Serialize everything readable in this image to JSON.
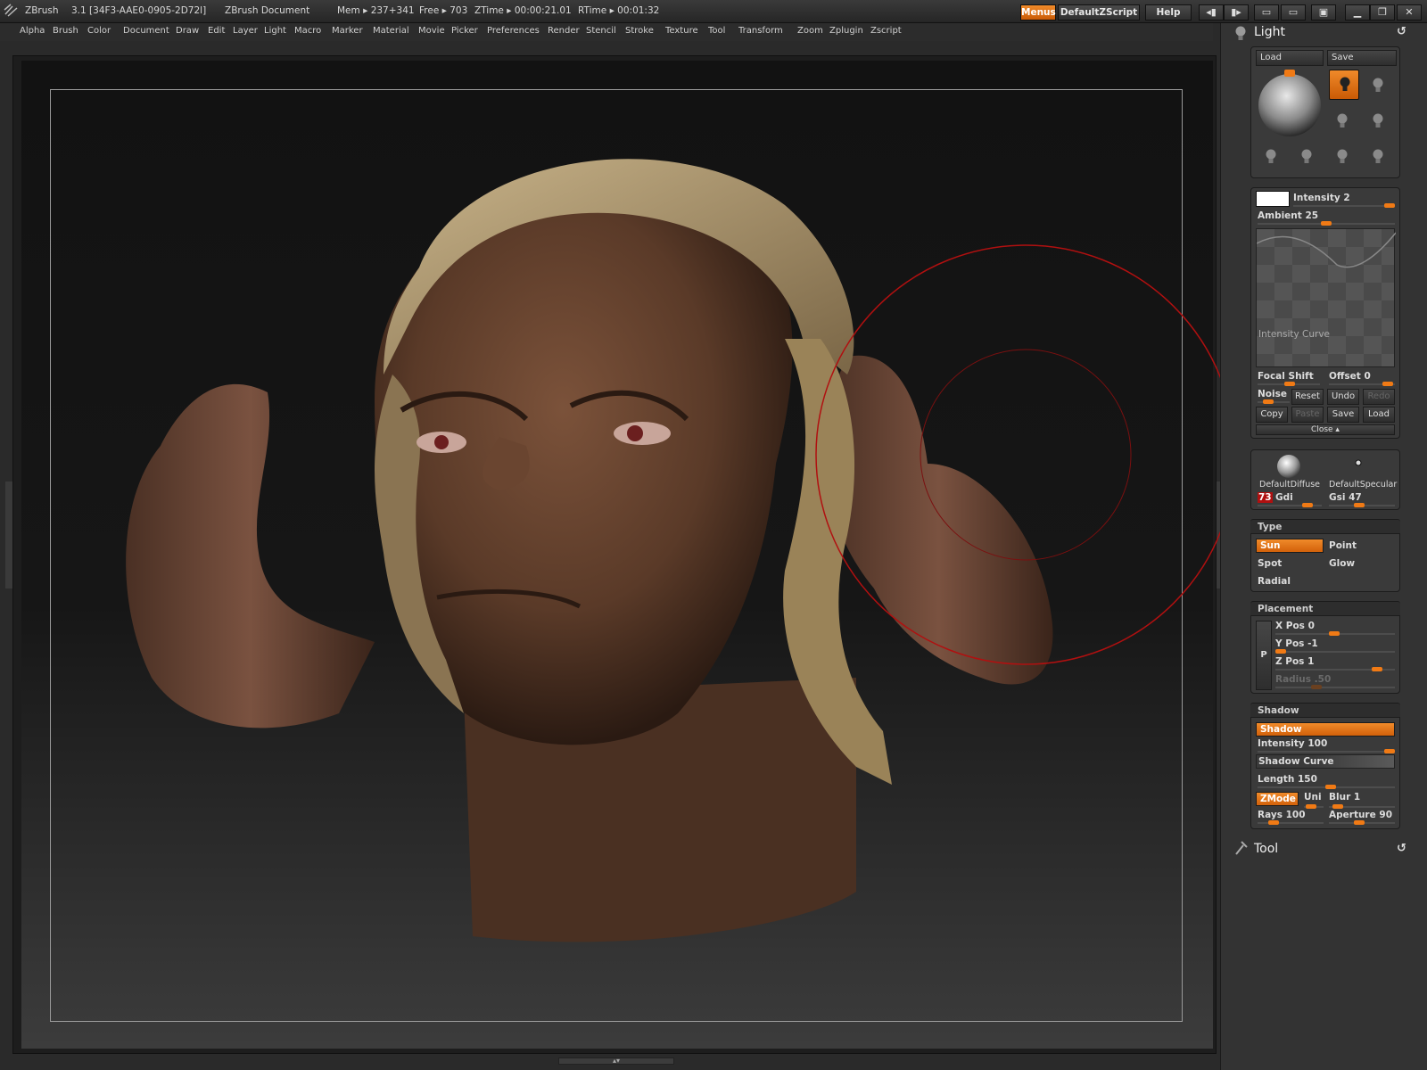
{
  "titlebar": {
    "app": "ZBrush",
    "version": "3.1 [34F3-AAE0-0905-2D72l]",
    "document": "ZBrush Document",
    "mem": "Mem ▸ 237+341",
    "free": "Free ▸ 703",
    "ztime": "ZTime ▸ 00:00:21.01",
    "rtime": "RTime ▸ 00:01:32",
    "menus_btn": "Menus",
    "zscript_btn": "DefaultZScript",
    "help_btn": "Help"
  },
  "menu": [
    "Alpha",
    "Brush",
    "Color",
    "Document",
    "Draw",
    "Edit",
    "Layer",
    "Light",
    "Macro",
    "Marker",
    "Material",
    "Movie",
    "Picker",
    "Preferences",
    "Render",
    "Stencil",
    "Stroke",
    "Texture",
    "Tool",
    "Transform",
    "Zoom",
    "Zplugin",
    "Zscript"
  ],
  "light_panel": {
    "title": "Light",
    "load": "Load",
    "save": "Save",
    "intensity": "Intensity 2",
    "intensity_value": 0.95,
    "ambient": "Ambient 25",
    "ambient_value": 0.5,
    "intensity_curve": "Intensity Curve",
    "focal_shift": "Focal Shift",
    "offset": "Offset 0",
    "noise": "Noise",
    "reset": "Reset",
    "undo": "Undo",
    "redo": "Redo",
    "copy": "Copy",
    "paste": "Paste",
    "curve_save": "Save",
    "curve_load": "Load",
    "close": "Close ▴",
    "diffuse_name": "DefaultDiffuse",
    "specular_name": "DefaultSpecular",
    "gdi_value": "73",
    "gdi_label": "Gdi",
    "gsi": "Gsi 47"
  },
  "type_section": {
    "title": "Type",
    "sun": "Sun",
    "point": "Point",
    "spot": "Spot",
    "glow": "Glow",
    "radial": "Radial"
  },
  "placement": {
    "title": "Placement",
    "p": "P",
    "xpos": "X Pos 0",
    "ypos": "Y Pos -1",
    "zpos": "Z Pos 1",
    "radius": "Radius .50"
  },
  "shadow": {
    "title": "Shadow",
    "shadow_btn": "Shadow",
    "intensity": "Intensity 100",
    "curve": "Shadow Curve",
    "length": "Length 150",
    "zmode": "ZMode",
    "uni": "Uni",
    "blur": "Blur 1",
    "rays": "Rays 100",
    "aperture": "Aperture 90"
  },
  "tool_panel": {
    "title": "Tool"
  },
  "colors": {
    "accent": "#f07a15",
    "panel": "#333333",
    "canvas": "#141414",
    "brush_ring": "#b01010"
  }
}
